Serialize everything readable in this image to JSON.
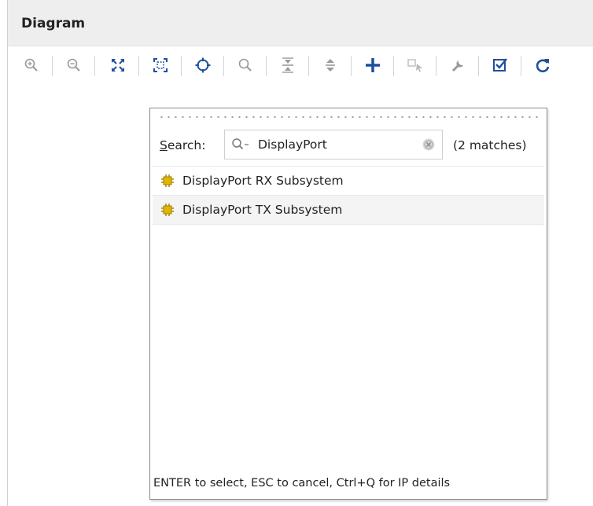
{
  "panel": {
    "title": "Diagram"
  },
  "toolbar": {
    "icons": [
      "zoom-in-icon",
      "zoom-out-icon",
      "fit-view-icon",
      "fit-selection-icon",
      "auto-connect-icon",
      "search-icon",
      "collapse-icon",
      "expand-icon",
      "add-ip-icon",
      "run-automation-icon",
      "customize-icon",
      "validate-icon",
      "regenerate-icon"
    ],
    "accent": "#1f4f9c"
  },
  "popup": {
    "search_label_prefix": "S",
    "search_label_rest": "earch:",
    "search_value": "DisplayPort",
    "matches": "(2 matches)",
    "results": [
      {
        "label": "DisplayPort RX Subsystem",
        "icon": "ip-core-icon"
      },
      {
        "label": "DisplayPort TX Subsystem",
        "icon": "ip-core-icon"
      }
    ],
    "hint": "ENTER to select, ESC to cancel, Ctrl+Q for IP details"
  },
  "colors": {
    "ip_icon": "#e0b400",
    "border": "#8c8c8c",
    "selected_row": "#f4f4f4"
  }
}
